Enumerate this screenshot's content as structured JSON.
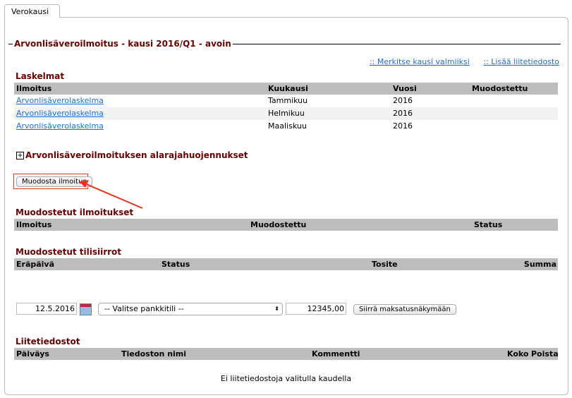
{
  "tab": "Verokausi",
  "title": "Arvonlisäveroilmoitus - kausi 2016/Q1 - avoin",
  "links": {
    "mark_done": ":: Merkitse kausi valmiiksi",
    "add_attachment": ":: Lisää liitetiedosto"
  },
  "laskelmat": {
    "heading": "Laskelmat",
    "columns": [
      "Ilmoitus",
      "Kuukausi",
      "Vuosi",
      "Muodostettu"
    ],
    "rows": [
      {
        "ilmoitus": "Arvonlisäverolaskelma",
        "kuukausi": "Tammikuu",
        "vuosi": "2016"
      },
      {
        "ilmoitus": "Arvonlisäverolaskelma",
        "kuukausi": "Helmikuu",
        "vuosi": "2016"
      },
      {
        "ilmoitus": "Arvonlisäverolaskelma",
        "kuukausi": "Maaliskuu",
        "vuosi": "2016"
      }
    ]
  },
  "relief": {
    "toggle": "+",
    "heading": "Arvonlisäveroilmoituksen alarajahuojennukset"
  },
  "create_button": "Muodosta ilmoitus",
  "ilmoitukset": {
    "heading": "Muodostetut ilmoitukset",
    "columns": [
      "Ilmoitus",
      "Muodostettu",
      "Status"
    ]
  },
  "tilisiirrot": {
    "heading": "Muodostetut tilisiirrot",
    "columns": [
      "Eräpäivä",
      "Status",
      "Tosite",
      "Summa"
    ]
  },
  "payment": {
    "date": "12.5.2016",
    "account": "-- Valitse pankkitili --",
    "amount": "12345,00",
    "transfer_button": "Siirrä maksatusnäkymään"
  },
  "liitteet": {
    "heading": "Liitetiedostot",
    "columns": [
      "Päiväys",
      "Tiedoston nimi",
      "Kommentti",
      "Koko",
      "Poista"
    ],
    "empty": "Ei liitetiedostoja valitulla kaudella"
  }
}
